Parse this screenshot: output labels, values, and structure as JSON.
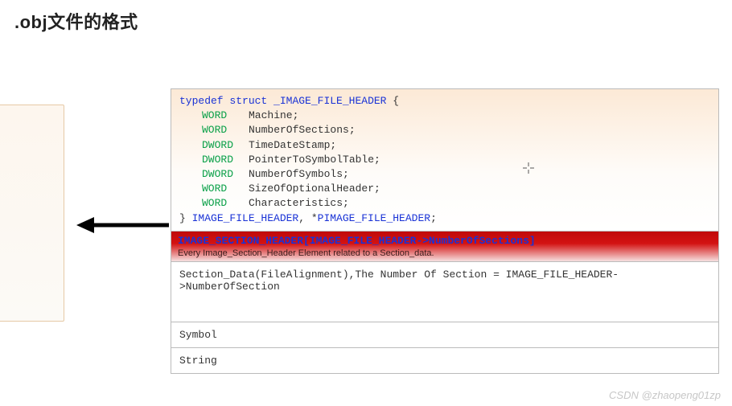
{
  "title": ".obj文件的格式",
  "code": {
    "l1_typedef": "typedef",
    "l1_struct": "struct",
    "l1_name": "_IMAGE_FILE_HEADER",
    "l1_brace": " {",
    "fields": [
      {
        "type": "WORD",
        "name": "Machine;"
      },
      {
        "type": "WORD",
        "name": "NumberOfSections;"
      },
      {
        "type": "DWORD",
        "name": "TimeDateStamp;"
      },
      {
        "type": "DWORD",
        "name": "PointerToSymbolTable;"
      },
      {
        "type": "DWORD",
        "name": "NumberOfSymbols;"
      },
      {
        "type": "WORD",
        "name": "SizeOfOptionalHeader;"
      },
      {
        "type": "WORD",
        "name": "Characteristics;"
      }
    ],
    "close_brace": "} ",
    "close_t1": "IMAGE_FILE_HEADER",
    "close_sep": ", *",
    "close_t2": "PIMAGE_FILE_HEADER",
    "close_semi": ";"
  },
  "red": {
    "line1": "IMAGE_SECTION_HEADER[IMAGE_FILE_HEADER->NumberOfSections]",
    "line2": "Every Image_Section_Header Element related to a Section_data."
  },
  "cell_section_data": "Section_Data(FileAlignment),The Number Of Section = IMAGE_FILE_HEADER->NumberOfSection",
  "cell_symbol": "Symbol",
  "cell_string": "String",
  "watermark": "CSDN @zhaopeng01zp"
}
